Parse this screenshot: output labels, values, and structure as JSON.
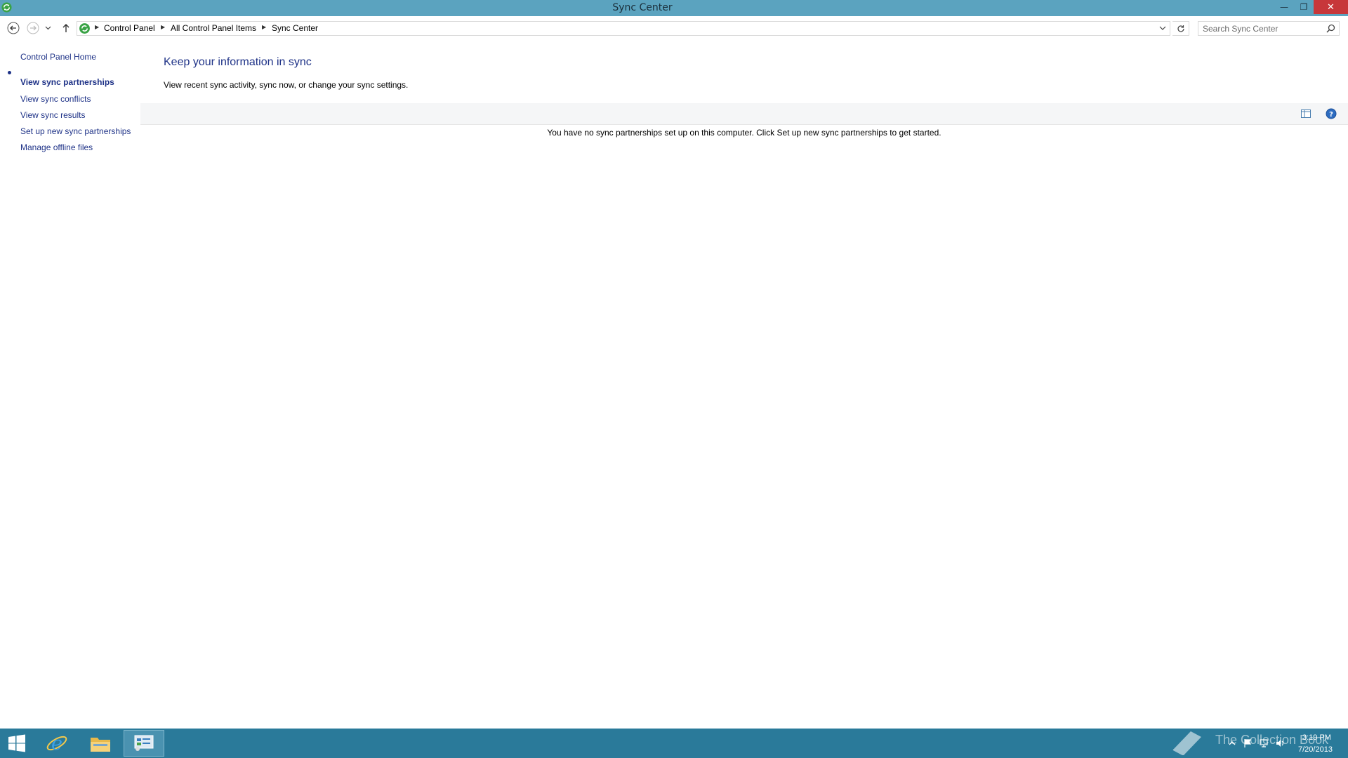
{
  "window": {
    "title": "Sync Center"
  },
  "titlebar": {
    "minimize_label": "—",
    "restore_label": "❐",
    "close_label": "✕"
  },
  "address": {
    "breadcrumbs": [
      "Control Panel",
      "All Control Panel Items",
      "Sync Center"
    ],
    "search_placeholder": "Search Sync Center"
  },
  "sidebar": {
    "home": "Control Panel Home",
    "items": [
      {
        "label": "View sync partnerships",
        "selected": true
      },
      {
        "label": "View sync conflicts"
      },
      {
        "label": "View sync results"
      },
      {
        "label": "Set up new sync partnerships"
      },
      {
        "label": "Manage offline files"
      }
    ]
  },
  "main": {
    "heading": "Keep your information in sync",
    "description": "View recent sync activity, sync now, or change your sync settings.",
    "empty_message": "You have no sync partnerships set up on this computer. Click Set up new sync partnerships to get started."
  },
  "taskbar": {
    "watermark": "The Collection Book",
    "time": "3:19 PM",
    "date": "7/20/2013"
  },
  "colors": {
    "titlebar": "#5ba3bf",
    "taskbar": "#2a7a9a",
    "link": "#1e3287",
    "close": "#c7373a"
  }
}
